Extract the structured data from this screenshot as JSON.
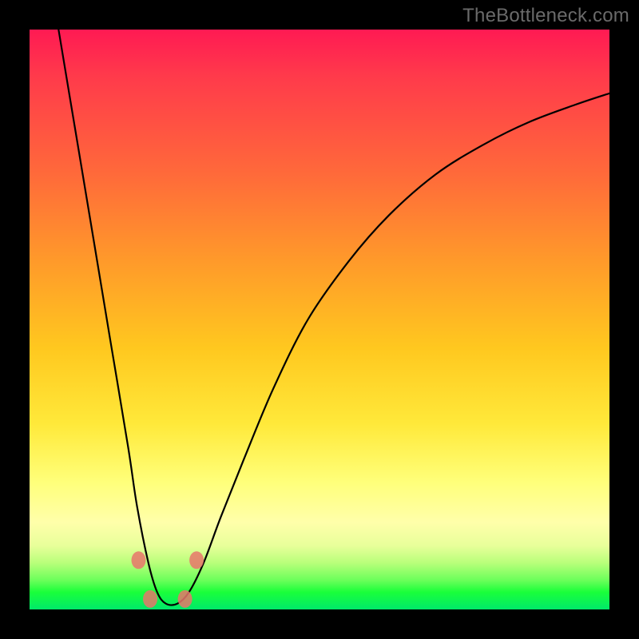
{
  "watermark": "TheBottleneck.com",
  "chart_data": {
    "type": "line",
    "title": "",
    "xlabel": "",
    "ylabel": "",
    "xlim": [
      0,
      100
    ],
    "ylim": [
      0,
      100
    ],
    "series": [
      {
        "name": "curve",
        "x": [
          5,
          8,
          11,
          14,
          17,
          18.5,
          20.5,
          22,
          23.5,
          25.5,
          27.5,
          30,
          33,
          37,
          42,
          48,
          55,
          62,
          70,
          78,
          86,
          94,
          100
        ],
        "y": [
          100,
          82,
          64,
          46,
          28,
          18,
          8,
          3,
          1,
          1,
          3,
          8,
          16,
          26,
          38,
          50,
          60,
          68,
          75,
          80,
          84,
          87,
          89
        ]
      }
    ],
    "markers": [
      {
        "x": 18.8,
        "y": 8.5
      },
      {
        "x": 20.8,
        "y": 1.8
      },
      {
        "x": 26.8,
        "y": 1.8
      },
      {
        "x": 28.8,
        "y": 8.5
      }
    ],
    "colors": {
      "curve": "#000000",
      "marker": "#e8756b",
      "gradient_top": "#ff1a53",
      "gradient_bottom": "#00e96a"
    }
  }
}
